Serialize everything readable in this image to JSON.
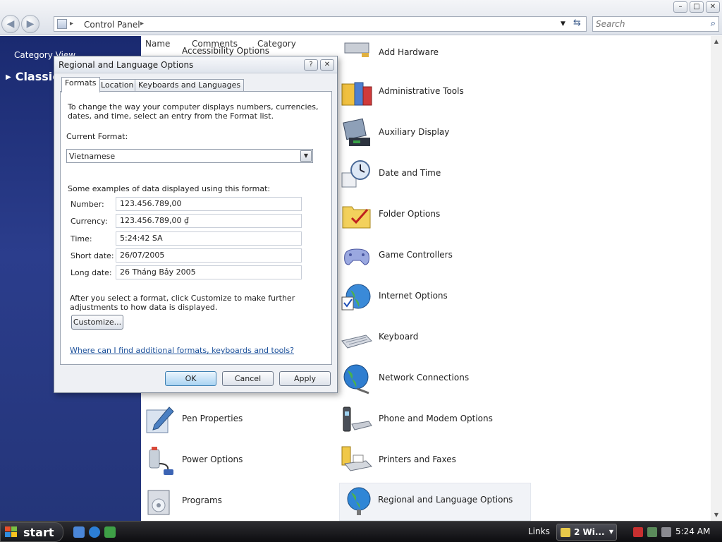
{
  "window": {
    "min_label": "–",
    "max_label": "□",
    "close_label": "✕",
    "back_label": "◀",
    "forward_label": "▶"
  },
  "address": {
    "path": "Control Panel",
    "sep": "▸",
    "dropdown": "▼",
    "refresh": "⇆"
  },
  "search": {
    "placeholder": "Search",
    "icon": "⌕"
  },
  "sidebar": {
    "category_view": "Category View",
    "classic": "Classic View",
    "classic_arrow": "▶"
  },
  "columns": {
    "name": "Name",
    "comments": "Comments",
    "category": "Category"
  },
  "items": [
    {
      "label": "Accessibility Options"
    },
    {
      "label": "Add Hardware"
    },
    {
      "label": "Administrative Tools"
    },
    {
      "label": "Auxiliary Display"
    },
    {
      "label": "Date and Time"
    },
    {
      "label": "Folder Options"
    },
    {
      "label": "Game Controllers"
    },
    {
      "label": "Internet Options"
    },
    {
      "label": "Keyboard"
    },
    {
      "label": "Network Connections"
    },
    {
      "label": "Pen Properties"
    },
    {
      "label": "Phone and Modem Options"
    },
    {
      "label": "Power Options"
    },
    {
      "label": "Printers and Faxes"
    },
    {
      "label": "Programs"
    },
    {
      "label": "Regional and Language Options"
    }
  ],
  "dialog": {
    "title": "Regional and Language Options",
    "help": "?",
    "close": "✕",
    "tabs": [
      "Formats",
      "Location",
      "Keyboards and Languages"
    ],
    "description": "To change the way your computer displays numbers, currencies, dates, and time, select an entry from the Format list.",
    "current_format_label": "Current Format:",
    "current_format_value": "Vietnamese",
    "dropdown_arrow": "▼",
    "examples_label": "Some examples of data displayed using this format:",
    "examples": [
      {
        "key": "Number:",
        "value": "123.456.789,00"
      },
      {
        "key": "Currency:",
        "value": "123.456.789,00 ₫"
      },
      {
        "key": "Time:",
        "value": "5:24:42 SA"
      },
      {
        "key": "Short date:",
        "value": "26/07/2005"
      },
      {
        "key": "Long date:",
        "value": "26 Tháng Bảy 2005"
      }
    ],
    "after_text": "After you select a format, click Customize to make further adjustments to how data is displayed.",
    "customize": "Customize...",
    "link": "Where can I find additional formats, keyboards and tools?",
    "ok": "OK",
    "cancel": "Cancel",
    "apply": "Apply"
  },
  "taskbar": {
    "start": "start",
    "links": "Links",
    "task": "2 Wi...",
    "task_drop": "▼",
    "clock": "5:24 AM"
  },
  "colors": {
    "sidebar": "#2b3d8c",
    "link": "#1a4f9a",
    "taskbar": "#1a1a1e"
  }
}
